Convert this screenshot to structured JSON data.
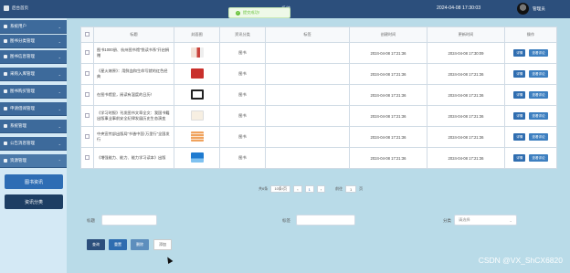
{
  "header": {
    "brand": "后台首页",
    "system_title": "系统",
    "datetime": "2024-04-08 17:30:03",
    "username": "管理员"
  },
  "toast": {
    "message": "提交成功!"
  },
  "sidebar": {
    "items": [
      {
        "label": "系统用户",
        "icon": "user-icon"
      },
      {
        "label": "图书分类管理",
        "icon": "category-icon"
      },
      {
        "label": "图书信息管理",
        "icon": "book-icon"
      },
      {
        "label": "采购入库管理",
        "icon": "inbox-icon"
      },
      {
        "label": "图书购买管理",
        "icon": "cart-icon"
      },
      {
        "label": "申请借阅管理",
        "icon": "request-icon"
      },
      {
        "label": "系统管理",
        "icon": "settings-icon"
      },
      {
        "label": "公告消息管理",
        "icon": "notice-icon"
      },
      {
        "label": "资源管理",
        "icon": "resource-icon"
      }
    ],
    "buttons": [
      "图书资讯",
      "资讯分类"
    ]
  },
  "table": {
    "headers": [
      "标题",
      "封面图",
      "资讯分类",
      "标签",
      "创建时间",
      "更新时间",
      "操作"
    ],
    "rows": [
      {
        "title": "图书1000册、杭州图书馆“悦读书系”开启捐赠",
        "category": "图书",
        "tag": "",
        "created": "2024-04-08 17:21:36",
        "updated": "2024-04-08 17:30:09"
      },
      {
        "title": "《星火燎原》：用鲜血和生命写就的红色经典",
        "category": "图书",
        "tag": "",
        "created": "2024-04-08 17:21:36",
        "updated": "2024-04-08 17:21:36"
      },
      {
        "title": "在图书馆里，阅读有温度的日历！",
        "category": "图书",
        "tag": "",
        "created": "2024-04-08 17:21:36",
        "updated": "2024-04-08 17:21:36"
      },
      {
        "title": "《学习时报》刊发图书文章全文：我国书籍出版事业事前安全纪律发展历史生态演变",
        "category": "图书",
        "tag": "",
        "created": "2024-04-08 17:21:36",
        "updated": "2024-04-08 17:21:36"
      },
      {
        "title": "中央宣传部出版局“书香中国·万里行”全国发行",
        "category": "图书",
        "tag": "",
        "created": "2024-04-08 17:21:36",
        "updated": "2024-04-08 17:21:36"
      },
      {
        "title": "《增强能力、能力、能力学习读本》出版",
        "category": "图书",
        "tag": "",
        "created": "2024-04-08 17:21:36",
        "updated": "2024-04-08 17:21:36"
      }
    ],
    "actions": {
      "detail": "详情",
      "review": "查看评论"
    }
  },
  "pager": {
    "total_label": "共6条",
    "page_size": "10条/页",
    "current_page": "1",
    "goto_label": "前往",
    "goto_value": "1",
    "page_suffix": "页"
  },
  "search": {
    "title_label": "标题",
    "tag_label": "标签",
    "category_label": "分类",
    "category_placeholder": "请选择"
  },
  "buttons": {
    "query": "查询",
    "reset": "重置",
    "delete": "删除",
    "add": "添加"
  },
  "watermark": "CSDN @VX_ShCX6820",
  "colors": {
    "header_bg": "#2c4f7c",
    "sidebar_item": "#3d6a9b",
    "primary": "#2f6db0",
    "page_bg": "#b9dbe8"
  }
}
